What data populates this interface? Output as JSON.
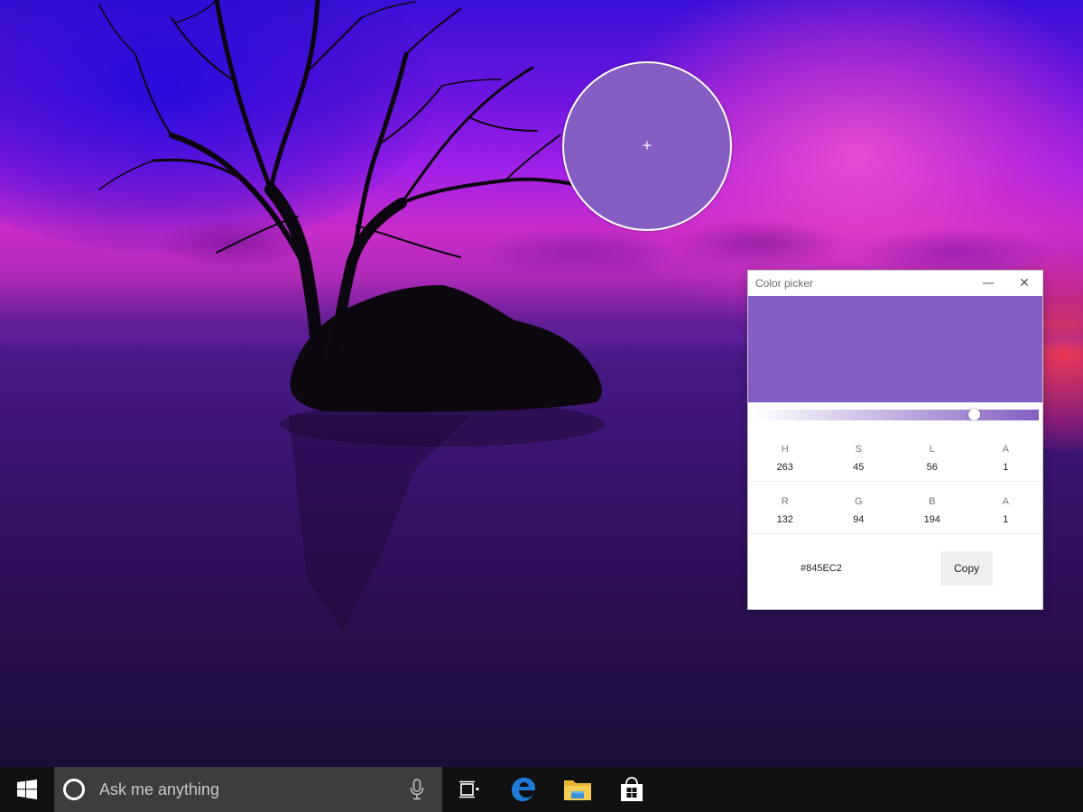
{
  "colors": {
    "picked": "#845EC2",
    "window_bg": "#ffffff",
    "taskbar": "#111111",
    "search_bg": "#3d3d3d"
  },
  "picker_window": {
    "title": "Color picker",
    "minimize_glyph": "—",
    "close_glyph": "✕",
    "swatch_color": "#845EC2",
    "lightness_slider": {
      "value": 0.77
    },
    "hsla": {
      "labels": [
        "H",
        "S",
        "L",
        "A"
      ],
      "values": [
        "263",
        "45",
        "56",
        "1"
      ]
    },
    "rgba": {
      "labels": [
        "R",
        "G",
        "B",
        "A"
      ],
      "values": [
        "132",
        "94",
        "194",
        "1"
      ]
    },
    "hex": "#845EC2",
    "copy_label": "Copy"
  },
  "loupe": {
    "crosshair": "+",
    "color": "#845EC2"
  },
  "taskbar": {
    "search_placeholder": "Ask me anything",
    "icons": [
      "windows-start-icon",
      "cortana-icon",
      "microphone-icon",
      "task-view-icon",
      "edge-icon",
      "file-explorer-icon",
      "store-icon"
    ]
  }
}
